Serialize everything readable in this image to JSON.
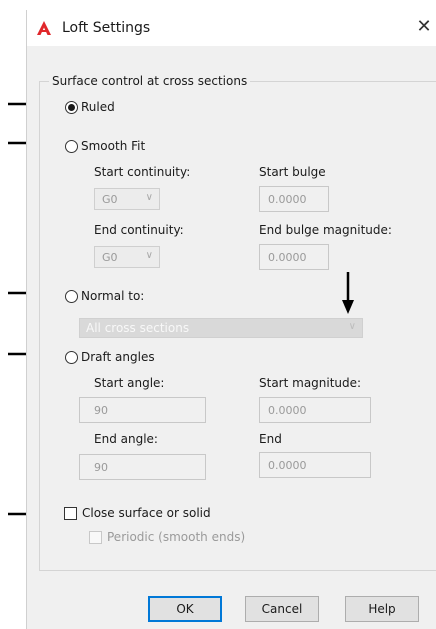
{
  "window": {
    "title": "Loft Settings",
    "close_glyph": "✕"
  },
  "group": {
    "legend": "Surface control at cross sections"
  },
  "options": {
    "ruled": "Ruled",
    "smooth_fit": "Smooth Fit",
    "normal_to": "Normal to:",
    "draft_angles": "Draft angles"
  },
  "smooth_fit": {
    "start_continuity_label": "Start continuity:",
    "start_continuity_value": "G0",
    "start_bulge_label": "Start bulge",
    "start_bulge_value": "0.0000",
    "end_continuity_label": "End continuity:",
    "end_continuity_value": "G0",
    "end_bulge_label": "End bulge magnitude:",
    "end_bulge_value": "0.0000"
  },
  "normal_to": {
    "value": "All cross sections"
  },
  "draft": {
    "start_angle_label": "Start angle:",
    "start_angle_value": "90",
    "start_magnitude_label": "Start magnitude:",
    "start_magnitude_value": "0.0000",
    "end_angle_label": "End angle:",
    "end_angle_value": "90",
    "end_label": "End",
    "end_value": "0.0000"
  },
  "close": {
    "label": "Close surface or solid",
    "periodic_label": "Periodic (smooth ends)"
  },
  "buttons": {
    "ok": "OK",
    "cancel": "Cancel",
    "help": "Help"
  },
  "state": {
    "selected_option": "ruled",
    "close_checked": false,
    "periodic_enabled": false
  },
  "colors": {
    "logo_red": "#e0272b",
    "accent": "#0078d7",
    "arrow": "#000000"
  }
}
